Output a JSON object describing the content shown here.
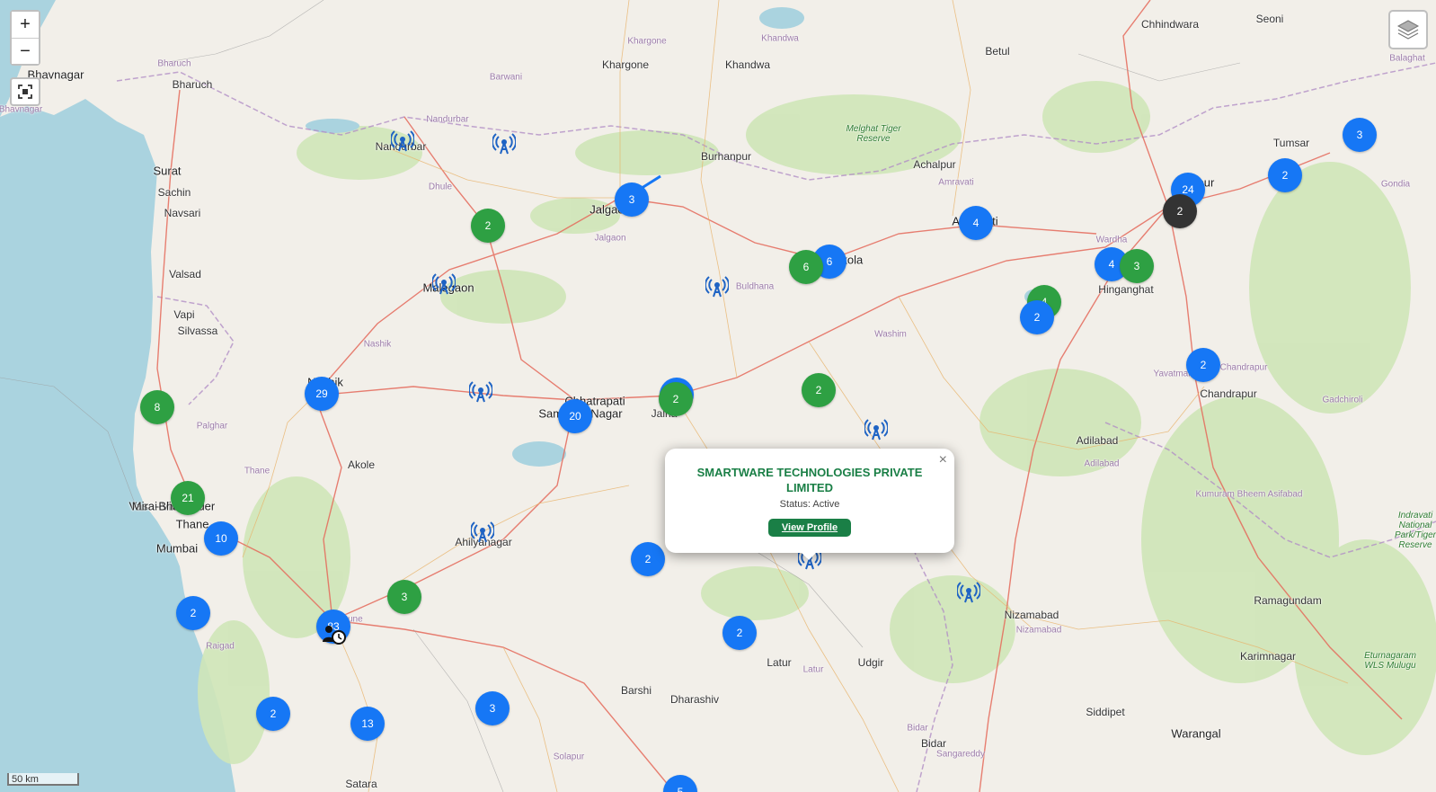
{
  "controls": {
    "zoom_in": "+",
    "zoom_out": "−",
    "fit_icon": "fullscreen-icon",
    "layers_icon": "layers-icon",
    "scale": "50 km"
  },
  "colors": {
    "cluster_blue": "#1677f5",
    "cluster_green": "#2ea043",
    "cluster_dark": "#333333",
    "popup_accent": "#1a7f46",
    "sea": "#aad3df"
  },
  "popup": {
    "company": "SMARTWARE TECHNOLOGIES PRIVATE LIMITED",
    "status": "Status: Active",
    "button": "View Profile",
    "close": "×"
  },
  "places": [
    {
      "name": "Bhavnagar",
      "style": "big"
    },
    {
      "name": "Bharuch",
      "style": "normal"
    },
    {
      "name": "Bharuch",
      "style": "district"
    },
    {
      "name": "Bhavnagar",
      "style": "district"
    },
    {
      "name": "Surat",
      "style": "big"
    },
    {
      "name": "Sachin",
      "style": "normal"
    },
    {
      "name": "Navsari",
      "style": "normal"
    },
    {
      "name": "Valsad",
      "style": "normal"
    },
    {
      "name": "Vapi",
      "style": "normal"
    },
    {
      "name": "Silvassa",
      "style": "normal"
    },
    {
      "name": "Nandurbar",
      "style": "district"
    },
    {
      "name": "Nandurbar",
      "style": "normal"
    },
    {
      "name": "Dhule",
      "style": "district"
    },
    {
      "name": "Barwani",
      "style": "district"
    },
    {
      "name": "Khargone",
      "style": "district"
    },
    {
      "name": "Khargone",
      "style": "normal"
    },
    {
      "name": "Khandwa",
      "style": "district"
    },
    {
      "name": "Khandwa",
      "style": "normal"
    },
    {
      "name": "Burhanpur",
      "style": "normal"
    },
    {
      "name": "Jalgaon",
      "style": "big"
    },
    {
      "name": "Jalgaon",
      "style": "district"
    },
    {
      "name": "Malegaon",
      "style": "big"
    },
    {
      "name": "Nashik",
      "style": "district"
    },
    {
      "name": "Nashik",
      "style": "big"
    },
    {
      "name": "Palghar",
      "style": "district"
    },
    {
      "name": "Vasai-Virar",
      "style": "big"
    },
    {
      "name": "Mira-Bhayander",
      "style": "big"
    },
    {
      "name": "Thane",
      "style": "big"
    },
    {
      "name": "Thane",
      "style": "district"
    },
    {
      "name": "Mumbai",
      "style": "big"
    },
    {
      "name": "Akole",
      "style": "normal"
    },
    {
      "name": "Raigad",
      "style": "district"
    },
    {
      "name": "Pune",
      "style": "district"
    },
    {
      "name": "Satara",
      "style": "normal"
    },
    {
      "name": "Chhatrapati",
      "style": "big"
    },
    {
      "name": "Sambhaji Nagar",
      "style": "big"
    },
    {
      "name": "Jalna",
      "style": "normal"
    },
    {
      "name": "Ahilyanagar",
      "style": "normal"
    },
    {
      "name": "Buldhana",
      "style": "district"
    },
    {
      "name": "Akola",
      "style": "big"
    },
    {
      "name": "Betul",
      "style": "normal"
    },
    {
      "name": "Melghat Tiger Reserve",
      "style": "park"
    },
    {
      "name": "Achalpur",
      "style": "normal"
    },
    {
      "name": "Amravati",
      "style": "district"
    },
    {
      "name": "Amravati",
      "style": "big"
    },
    {
      "name": "Washim",
      "style": "district"
    },
    {
      "name": "Wardha",
      "style": "district"
    },
    {
      "name": "Hinganghat",
      "style": "normal"
    },
    {
      "name": "Yavatmal",
      "style": "district"
    },
    {
      "name": "Chhindwara",
      "style": "normal"
    },
    {
      "name": "Seoni",
      "style": "normal"
    },
    {
      "name": "Balaghat",
      "style": "district"
    },
    {
      "name": "Tumsar",
      "style": "normal"
    },
    {
      "name": "Gondia",
      "style": "district"
    },
    {
      "name": "Nagpur",
      "style": "big"
    },
    {
      "name": "Chandrapur",
      "style": "district"
    },
    {
      "name": "Chandrapur",
      "style": "normal"
    },
    {
      "name": "Gadchiroli",
      "style": "district"
    },
    {
      "name": "Adilabad",
      "style": "normal"
    },
    {
      "name": "Adilabad",
      "style": "district"
    },
    {
      "name": "Kumuram Bheem Asifabad",
      "style": "district"
    },
    {
      "name": "Indravati National Park/Tiger Reserve",
      "style": "park"
    },
    {
      "name": "Ramagundam",
      "style": "normal"
    },
    {
      "name": "Karimnagar",
      "style": "normal"
    },
    {
      "name": "Eturnagaram WLS Mulugu",
      "style": "park"
    },
    {
      "name": "Nizamabad",
      "style": "normal"
    },
    {
      "name": "Nizamabad",
      "style": "district"
    },
    {
      "name": "Siddipet",
      "style": "normal"
    },
    {
      "name": "Warangal",
      "style": "big"
    },
    {
      "name": "Udgir",
      "style": "normal"
    },
    {
      "name": "Latur",
      "style": "normal"
    },
    {
      "name": "Latur",
      "style": "district"
    },
    {
      "name": "Barshi",
      "style": "normal"
    },
    {
      "name": "Dharashiv",
      "style": "normal"
    },
    {
      "name": "Solapur",
      "style": "district"
    },
    {
      "name": "Bidar",
      "style": "district"
    },
    {
      "name": "Bidar",
      "style": "normal"
    },
    {
      "name": "Sangareddy",
      "style": "district"
    }
  ],
  "clusters": [
    {
      "count": "3",
      "color": "blue"
    },
    {
      "count": "2",
      "color": "green"
    },
    {
      "count": "6",
      "color": "blue"
    },
    {
      "count": "6",
      "color": "green"
    },
    {
      "count": "4",
      "color": "blue"
    },
    {
      "count": "4",
      "color": "blue"
    },
    {
      "count": "3",
      "color": "green"
    },
    {
      "count": "4",
      "color": "green"
    },
    {
      "count": "2",
      "color": "blue"
    },
    {
      "count": "24",
      "color": "blue"
    },
    {
      "count": "2",
      "color": "dark"
    },
    {
      "count": "2",
      "color": "blue"
    },
    {
      "count": "3",
      "color": "blue"
    },
    {
      "count": "2",
      "color": "blue"
    },
    {
      "count": "8",
      "color": "green"
    },
    {
      "count": "29",
      "color": "blue"
    },
    {
      "count": "20",
      "color": "blue"
    },
    {
      "count": "2",
      "color": "blue"
    },
    {
      "count": "2",
      "color": "green"
    },
    {
      "count": "2",
      "color": "green"
    },
    {
      "count": "21",
      "color": "green"
    },
    {
      "count": "10",
      "color": "blue"
    },
    {
      "count": "2",
      "color": "blue"
    },
    {
      "count": "83",
      "color": "blue"
    },
    {
      "count": "3",
      "color": "green"
    },
    {
      "count": "2",
      "color": "blue"
    },
    {
      "count": "2",
      "color": "blue"
    },
    {
      "count": "2",
      "color": "blue"
    },
    {
      "count": "13",
      "color": "blue"
    },
    {
      "count": "3",
      "color": "blue"
    },
    {
      "count": "5",
      "color": "blue"
    }
  ],
  "tower_icon": "radio-tower-icon",
  "user_marker_icon": "user-clock-icon"
}
